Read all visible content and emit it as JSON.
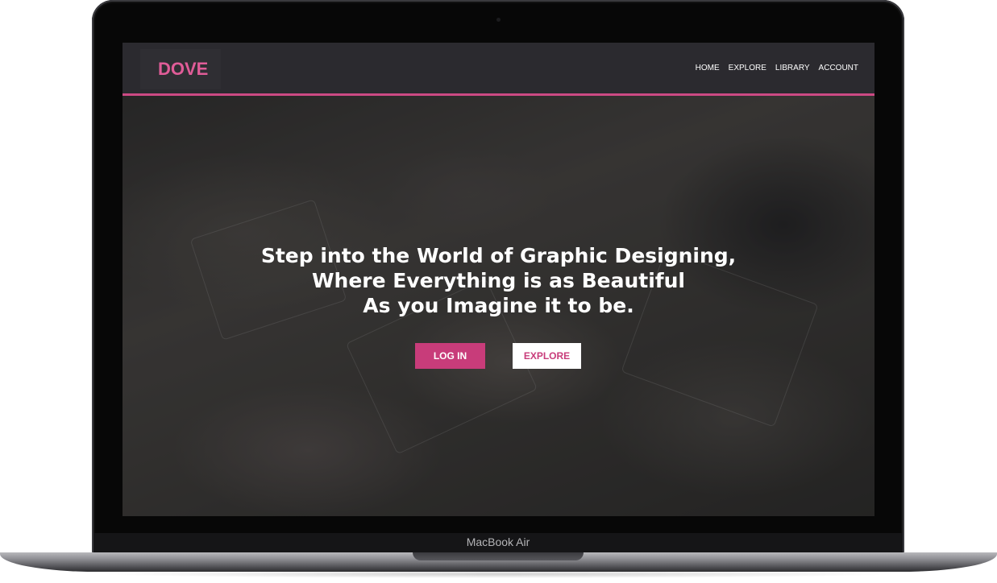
{
  "device": {
    "label": "MacBook Air"
  },
  "site": {
    "brand": "DOVE",
    "accent_color": "#cc4a84",
    "nav": [
      {
        "label": "HOME"
      },
      {
        "label": "EXPLORE"
      },
      {
        "label": "LIBRARY"
      },
      {
        "label": "ACCOUNT"
      }
    ]
  },
  "hero": {
    "headline_lines": [
      "Step into the World of Graphic Designing,",
      "Where Everything is as Beautiful",
      "As you Imagine it to be."
    ],
    "login_label": "LOG IN",
    "explore_label": "EXPLORE",
    "background": "dimmed photo of people drawing with markers and scissors on paper sheets"
  }
}
